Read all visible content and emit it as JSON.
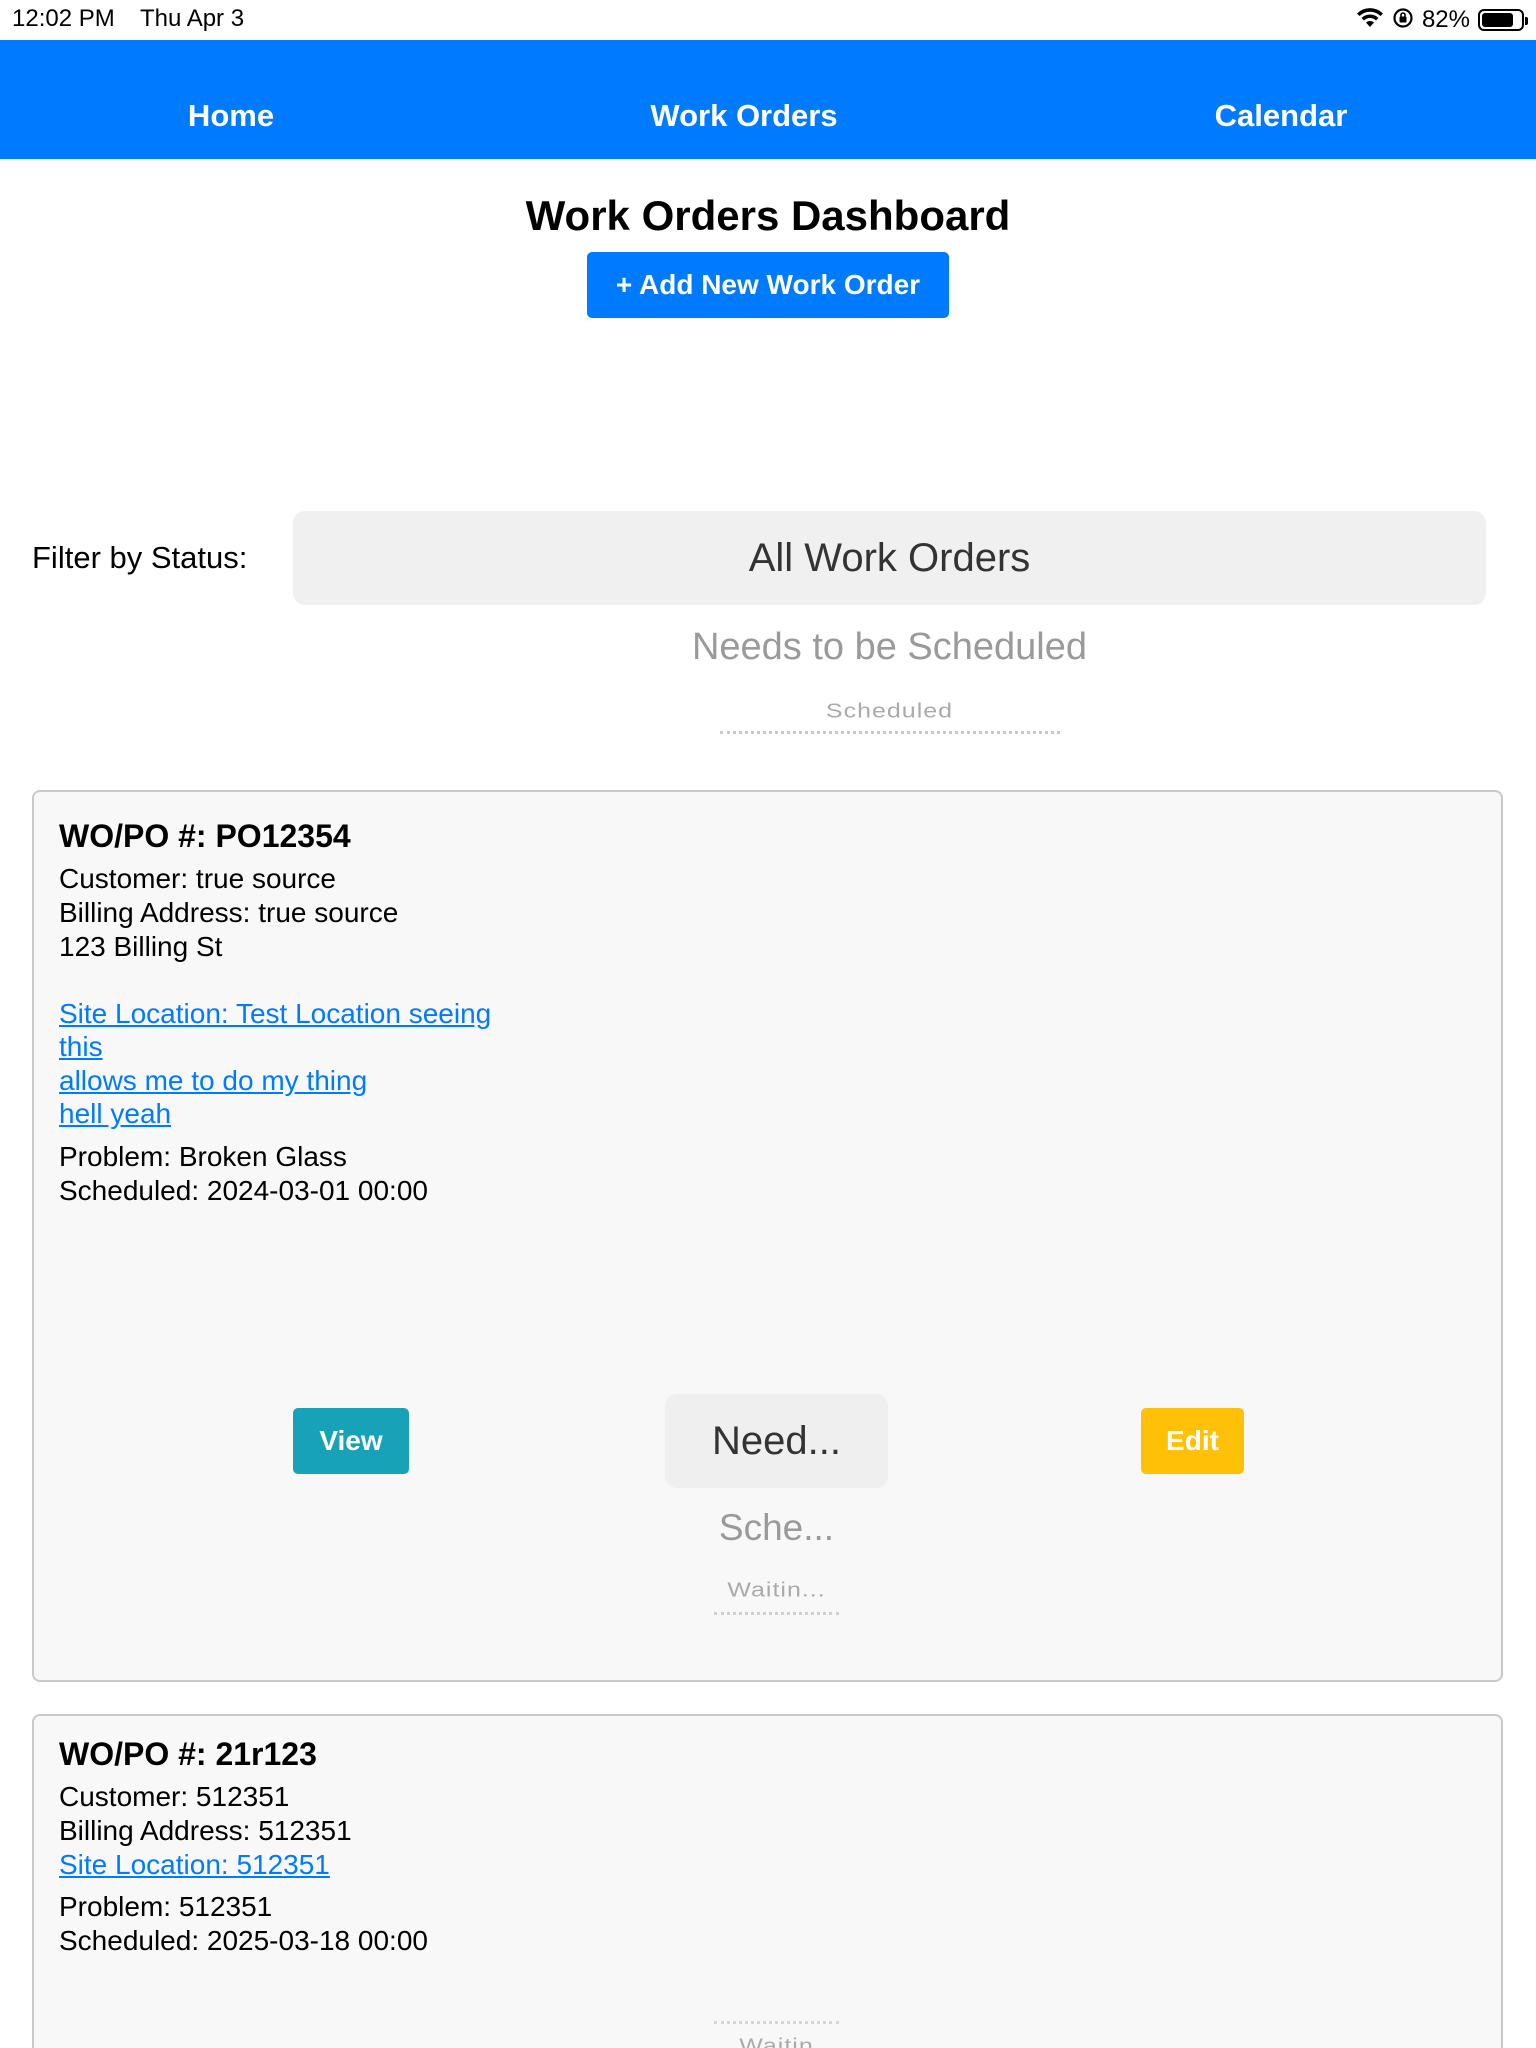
{
  "status_bar": {
    "time": "12:02 PM",
    "date": "Thu Apr 3",
    "battery_percent": "82%",
    "battery_level": 0.82,
    "icons": [
      "wifi-icon",
      "orientation-lock-icon",
      "battery-icon"
    ]
  },
  "nav": {
    "items": [
      {
        "label": "Home"
      },
      {
        "label": "Work Orders"
      },
      {
        "label": "Calendar"
      }
    ],
    "background": "#007bff"
  },
  "header": {
    "title": "Work Orders Dashboard",
    "add_button": "+ Add New Work Order"
  },
  "filter": {
    "label": "Filter by Status:",
    "selected": "All Work Orders",
    "visible_options": [
      "Needs to be Scheduled",
      "Scheduled"
    ]
  },
  "work_orders": [
    {
      "wo_po": "WO/PO #: PO12354",
      "customer": "Customer: true source",
      "billing_line1": "Billing Address: true source",
      "billing_line2": "123 Billing St",
      "site_lines": [
        "Site Location: Test Location seeing",
        "this",
        "allows me to do my thing",
        "hell yeah"
      ],
      "problem": "Problem: Broken Glass",
      "scheduled": "Scheduled: 2024-03-01 00:00",
      "view_label": "View",
      "edit_label": "Edit",
      "status_selected": "Need...",
      "status_options": [
        "Sche...",
        "Waitin..."
      ]
    },
    {
      "wo_po": "WO/PO #: 21r123",
      "customer": "Customer: 512351",
      "billing_line1": "Billing Address: 512351",
      "site_lines": [
        "Site Location: 512351"
      ],
      "problem": "Problem: 512351",
      "scheduled": "Scheduled: 2025-03-18 00:00",
      "status_options": [
        "Waitin"
      ]
    }
  ],
  "colors": {
    "primary": "#007bff",
    "view_button": "#17a2b8",
    "edit_button": "#ffc107",
    "card_background": "#f8f8f8"
  }
}
